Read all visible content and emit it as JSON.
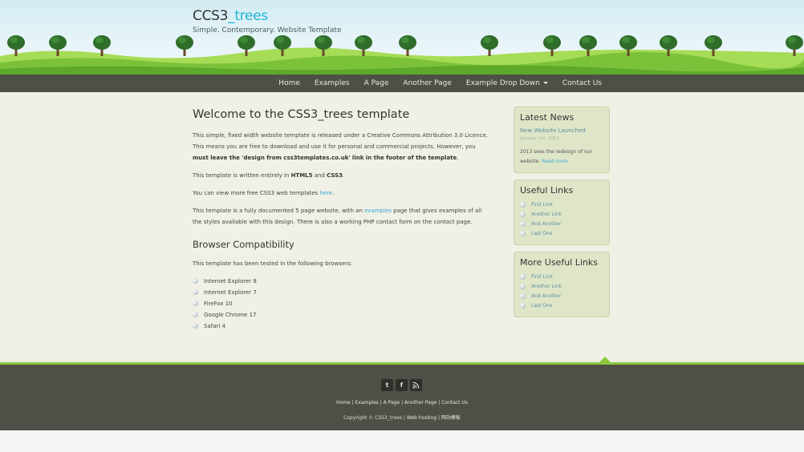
{
  "header": {
    "logo_main": "CCS3",
    "logo_accent": "_trees",
    "slogan": "Simple. Contemporary. Website Template"
  },
  "menu": {
    "items": [
      {
        "label": "Home"
      },
      {
        "label": "Examples"
      },
      {
        "label": "A Page"
      },
      {
        "label": "Another Page"
      },
      {
        "label": "Example Drop Down"
      },
      {
        "label": "Contact Us"
      }
    ]
  },
  "main": {
    "title": "Welcome to the CSS3_trees template",
    "p1_a": "This simple, fixed width website template is released under a Creative Commons Attribution 3.0 Licence. This means you are free to download and use it for personal and commercial projects. However, you ",
    "p1_b": "must leave the 'design from css3templates.co.uk' link in the footer of the template",
    "p1_c": ".",
    "p2_a": "This template is written entirely in ",
    "p2_b": "HTML5",
    "p2_c": " and ",
    "p2_d": "CSS3",
    "p2_e": ".",
    "p3_a": "You can view more free CSS3 web templates ",
    "p3_link": "here",
    "p3_b": ".",
    "p4_a": "This template is a fully documented 5 page website, with an ",
    "p4_link": "examples",
    "p4_b": " page that gives examples of all the styles available with this design. There is also a working PHP contact form on the contact page.",
    "h2": "Browser Compatibility",
    "p5": "This template has been tested in the following browsers:",
    "browsers": [
      "Internet Explorer 8",
      "Internet Explorer 7",
      "FireFox 10",
      "Google Chrome 17",
      "Safari 4"
    ]
  },
  "sidebar": {
    "news": {
      "title": "Latest News",
      "item_title": "New Website Launched",
      "date": "January 1st, 2013",
      "text": "2013 sees the redesign of our website. ",
      "read_more": "Read more"
    },
    "useful": {
      "title": "Useful Links",
      "links": [
        "First Link",
        "Another Link",
        "And Another",
        "Last One"
      ]
    },
    "more_useful": {
      "title": "More Useful Links",
      "links": [
        "First Link",
        "Another Link",
        "And Another",
        "Last One"
      ]
    }
  },
  "footer": {
    "social": [
      "t",
      "f",
      "rss"
    ],
    "links": [
      "Home",
      "Examples",
      "A Page",
      "Another Page",
      "Contact Us"
    ],
    "sep": " | ",
    "copyright": "Copyright © CSS3_trees",
    "web_hosting": "Web hosting",
    "cn_text": "网站模板"
  },
  "colors": {
    "accent": "#1bb6d8",
    "menu_bg": "#4e4f46",
    "green": "#8cc63e",
    "content_bg": "#f0f0e6",
    "box_bg": "#dfe6c8"
  }
}
